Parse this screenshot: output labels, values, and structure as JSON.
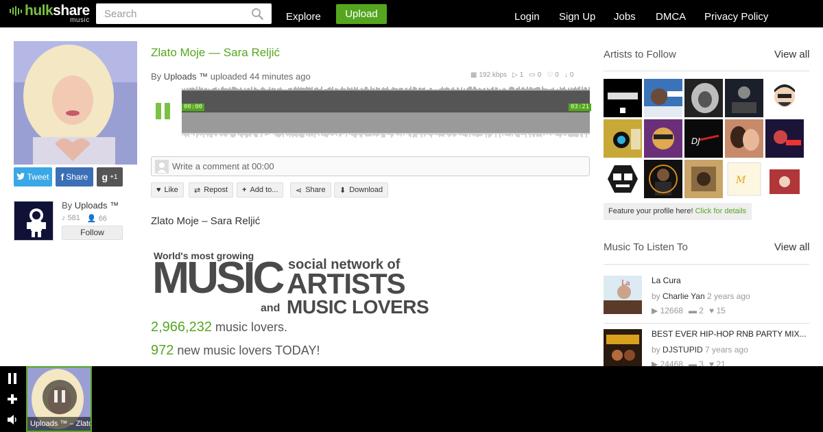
{
  "brand": {
    "name_a": "hulk",
    "name_b": "share",
    "sub": "music",
    "accent": "#7bc143"
  },
  "search": {
    "placeholder": "Search"
  },
  "nav": {
    "explore": "Explore",
    "upload": "Upload",
    "login": "Login",
    "signup": "Sign Up",
    "jobs": "Jobs",
    "dmca": "DMCA",
    "privacy": "Privacy Policy"
  },
  "share": {
    "tweet": "Tweet",
    "fb_glyph": "f",
    "share": "Share",
    "gplus_glyph": "g",
    "plus_one": "+1"
  },
  "uploader": {
    "by": "By",
    "name": "Uploads ™",
    "tracks": "581",
    "followers": "66",
    "follow": "Follow"
  },
  "track": {
    "title": "Zlato Moje — Sara Reljić",
    "by": "By",
    "user": "Uploads ™",
    "uploaded": "uploaded 44 minutes ago",
    "bitrate": "192 kbps",
    "plays": "1",
    "comments": "0",
    "likes": "0",
    "downloads": "0",
    "time_current": "00:00",
    "time_total": "03:21",
    "comment_placeholder": "Write a comment at 00:00",
    "description": "Zlato Moje – Sara Reljić"
  },
  "actions": {
    "like": "Like",
    "repost": "Repost",
    "add_to": "Add to...",
    "share": "Share",
    "download": "Download"
  },
  "promo": {
    "worlds": "World's most growing",
    "music": "MUSIC",
    "social": "social network of",
    "artists": "ARTISTS",
    "and": "and",
    "lovers": "MUSIC LOVERS",
    "count1": "2,966,232",
    "count1_label": "music lovers.",
    "count2": "972",
    "count2_label": "new music lovers TODAY!"
  },
  "sidebar": {
    "artists_title": "Artists to Follow",
    "view_all": "View all",
    "feature_text": "Feature your profile here!",
    "feature_link": "Click for details",
    "music_title": "Music To Listen To",
    "music_view_all": "View all",
    "tracks": [
      {
        "title": "La Cura",
        "by": "by",
        "user": "Charlie Yan",
        "ago": "2 years ago",
        "plays": "12668",
        "comments": "2",
        "likes": "15"
      },
      {
        "title": "BEST EVER HIP-HOP RNB PARTY MIX...",
        "by": "by",
        "user": "DJSTUPID",
        "ago": "7 years ago",
        "plays": "24468",
        "comments": "3",
        "likes": "21"
      }
    ]
  },
  "player": {
    "caption": "Uploads ™ – Zlato Moje — Sara Reljić"
  }
}
